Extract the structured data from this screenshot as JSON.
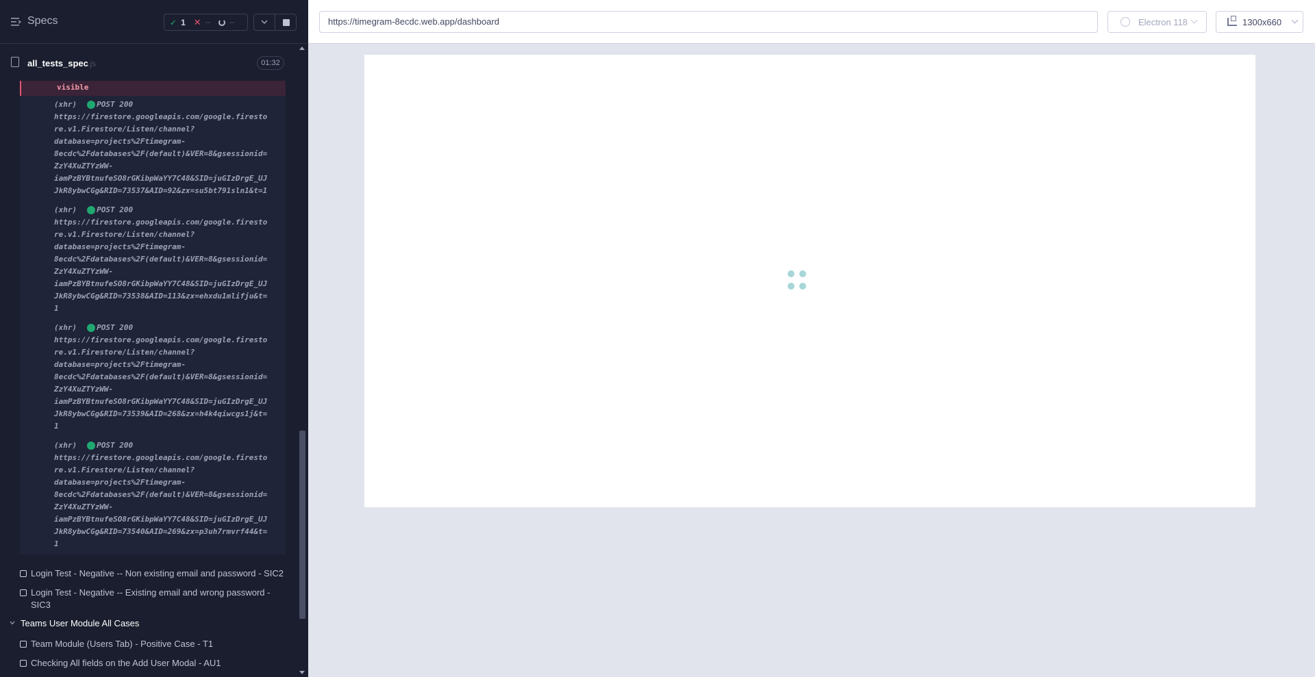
{
  "reporter": {
    "title": "Specs",
    "stats": {
      "passed": "1",
      "failed": "--",
      "pending": "--"
    },
    "spec": {
      "name": "all_tests_spec",
      "ext": ".js",
      "duration": "01:32"
    },
    "log": {
      "visible_text": "visible",
      "entries": [
        {
          "tag": "(xhr)",
          "status": "POST 200",
          "lines": [
            "https://firestore.googleapis.com/google.firesto",
            "re.v1.Firestore/Listen/channel?",
            "database=projects%2Ftimegram-",
            "8ecdc%2Fdatabases%2F(default)&VER=8&gsessionid=",
            "ZzY4XuZTYzWW-",
            "iamPzBYBtnufeSO8rGKibpWaYY7C48&SID=juGIzDrgE_UJ",
            "JkR8ybwCGg&RID=73537&AID=92&zx=su5bt791sln1&t=1"
          ]
        },
        {
          "tag": "(xhr)",
          "status": "POST 200",
          "lines": [
            "https://firestore.googleapis.com/google.firesto",
            "re.v1.Firestore/Listen/channel?",
            "database=projects%2Ftimegram-",
            "8ecdc%2Fdatabases%2F(default)&VER=8&gsessionid=",
            "ZzY4XuZTYzWW-",
            "iamPzBYBtnufeSO8rGKibpWaYY7C48&SID=juGIzDrgE_UJ",
            "JkR8ybwCGg&RID=73538&AID=113&zx=ehxdu1mlifju&t=",
            "1"
          ]
        },
        {
          "tag": "(xhr)",
          "status": "POST 200",
          "lines": [
            "https://firestore.googleapis.com/google.firesto",
            "re.v1.Firestore/Listen/channel?",
            "database=projects%2Ftimegram-",
            "8ecdc%2Fdatabases%2F(default)&VER=8&gsessionid=",
            "ZzY4XuZTYzWW-",
            "iamPzBYBtnufeSO8rGKibpWaYY7C48&SID=juGIzDrgE_UJ",
            "JkR8ybwCGg&RID=73539&AID=268&zx=h4k4qiwcgs1j&t=",
            "1"
          ]
        },
        {
          "tag": "(xhr)",
          "status": "POST 200",
          "lines": [
            "https://firestore.googleapis.com/google.firesto",
            "re.v1.Firestore/Listen/channel?",
            "database=projects%2Ftimegram-",
            "8ecdc%2Fdatabases%2F(default)&VER=8&gsessionid=",
            "ZzY4XuZTYzWW-",
            "iamPzBYBtnufeSO8rGKibpWaYY7C48&SID=juGIzDrgE_UJ",
            "JkR8ybwCGg&RID=73540&AID=269&zx=p3uh7rmvrf44&t=",
            "1"
          ]
        }
      ]
    },
    "tests": [
      {
        "label": "Login Test - Negative -- Non existing email and password - SIC2"
      },
      {
        "label": "Login Test - Negative -- Existing email and wrong password - SIC3"
      }
    ],
    "suite": {
      "label": "Teams User Module All Cases"
    },
    "suite_tests": [
      {
        "label": "Team Module (Users Tab) - Positive Case - T1"
      },
      {
        "label": "Checking All fields on the Add User Modal - AU1"
      }
    ]
  },
  "aut": {
    "url": "https://timegram-8ecdc.web.app/dashboard",
    "browser": "Electron 118",
    "viewport": "1300x660"
  },
  "colors": {
    "pass": "#1fa971",
    "fail": "#e45770",
    "loader": "#a7d6d7"
  }
}
